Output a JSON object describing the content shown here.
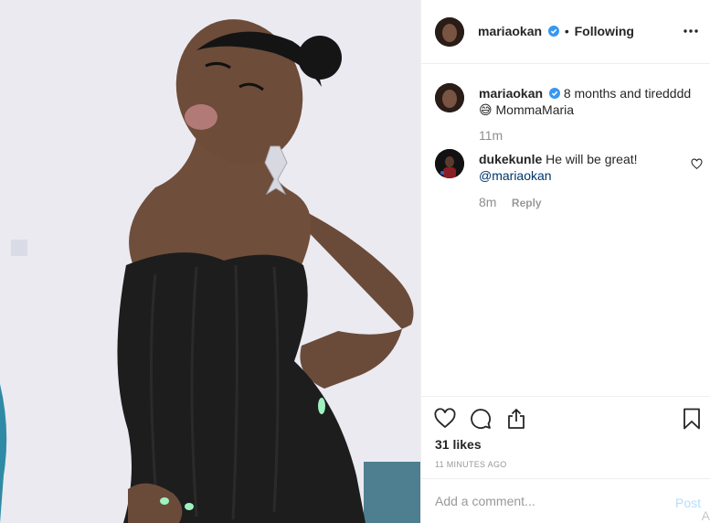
{
  "post": {
    "author": "mariaokan",
    "separator": "•",
    "follow_status": "Following",
    "more_icon": "ellipsis-icon"
  },
  "caption": {
    "username": "mariaokan",
    "text": "8 months and tiredddd",
    "emoji": "😅",
    "text_line2": "MommaMaria",
    "time": "11m"
  },
  "comments": [
    {
      "username": "dukekunle",
      "text": "He will be great!",
      "mention": "@mariaokan",
      "time": "8m",
      "reply_label": "Reply"
    }
  ],
  "actions": {
    "like_icon": "heart-icon",
    "comment_icon": "comment-bubble-icon",
    "share_icon": "share-icon",
    "save_icon": "bookmark-icon"
  },
  "likes": "31 likes",
  "posted_ago": "11 MINUTES AGO",
  "add_comment": {
    "placeholder": "Add a comment...",
    "post_label": "Post"
  },
  "stray_text": "A",
  "colors": {
    "verified": "#3897f0",
    "post_disabled": "#b2dffc",
    "mention": "#003569",
    "muted": "#8e8e8e"
  }
}
